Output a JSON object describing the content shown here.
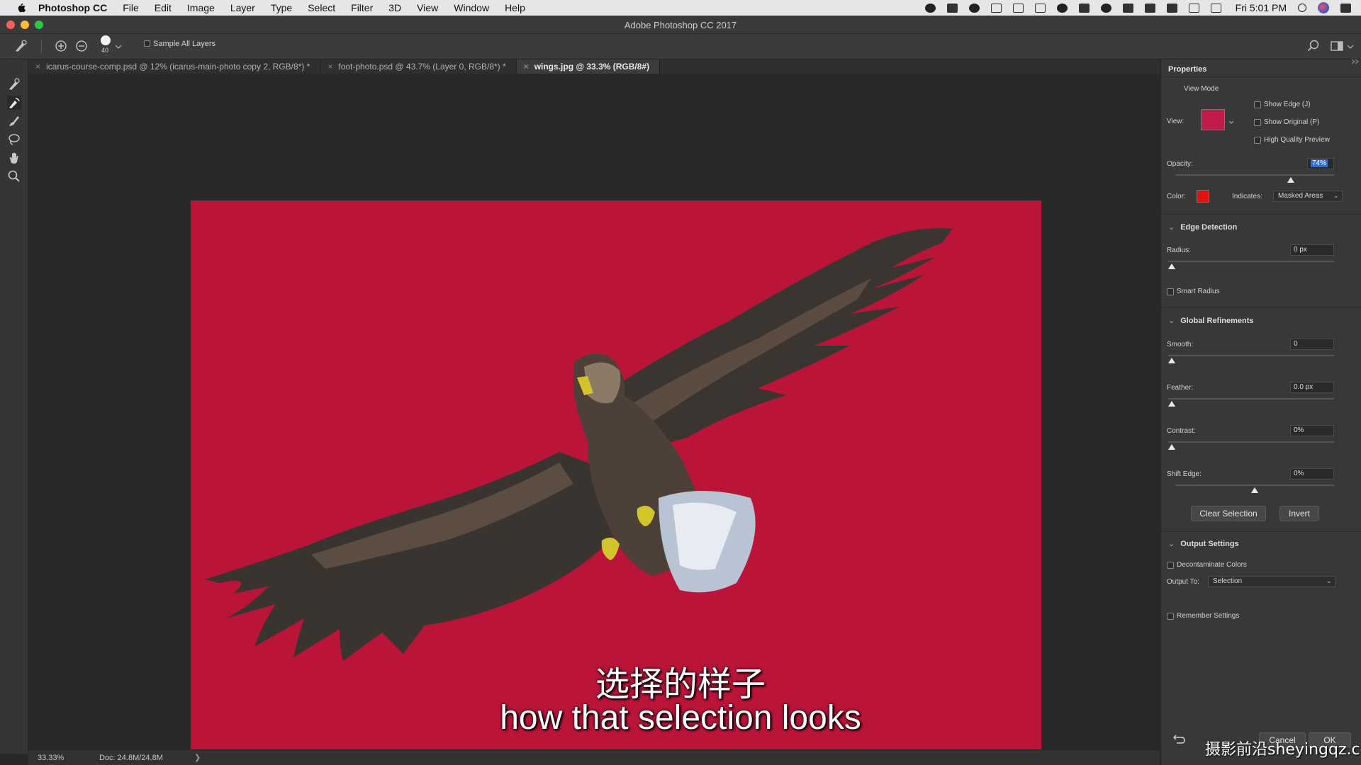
{
  "menubar": {
    "app_name": "Photoshop CC",
    "items": [
      "File",
      "Edit",
      "Image",
      "Layer",
      "Type",
      "Select",
      "Filter",
      "3D",
      "View",
      "Window",
      "Help"
    ],
    "clock": "Fri 5:01 PM"
  },
  "window": {
    "title": "Adobe Photoshop CC 2017"
  },
  "options_bar": {
    "brush_size": "40",
    "sample_all_layers_label": "Sample All Layers"
  },
  "tabs": [
    {
      "label": "icarus-course-comp.psd @ 12% (icarus-main-photo copy 2, RGB/8*) *"
    },
    {
      "label": "foot-photo.psd @ 43.7% (Layer 0, RGB/8*) *"
    },
    {
      "label": "wings.jpg @ 33.3% (RGB/8#)"
    }
  ],
  "status": {
    "zoom": "33.33%",
    "doc": "Doc: 24.8M/24.8M",
    "arrow": "❯"
  },
  "properties": {
    "title": "Properties",
    "view_mode": {
      "heading": "View Mode",
      "view_label": "View:",
      "show_edge": "Show Edge (J)",
      "show_original": "Show Original (P)",
      "high_quality_preview": "High Quality Preview"
    },
    "opacity_label": "Opacity:",
    "opacity_value": "74%",
    "opacity_level": 0.74,
    "color_label": "Color:",
    "color_value": "#e4110f",
    "indicates_label": "Indicates:",
    "indicates_value": "Masked Areas",
    "edge_detection": {
      "heading": "Edge Detection",
      "radius_label": "Radius:",
      "radius_value": "0 px",
      "smart_radius": "Smart Radius"
    },
    "global_refinements": {
      "heading": "Global Refinements",
      "smooth_label": "Smooth:",
      "smooth_value": "0",
      "feather_label": "Feather:",
      "feather_value": "0.0 px",
      "contrast_label": "Contrast:",
      "contrast_value": "0%",
      "shift_edge_label": "Shift Edge:",
      "shift_edge_value": "0%"
    },
    "clear_selection_label": "Clear Selection",
    "invert_label": "Invert",
    "output_settings": {
      "heading": "Output Settings",
      "decontaminate": "Decontaminate Colors",
      "output_to_label": "Output To:",
      "output_to_value": "Selection",
      "remember": "Remember Settings"
    },
    "cancel_label": "Cancel",
    "ok_label": "OK"
  },
  "subtitles": {
    "cn": "选择的样子",
    "en": "how that selection looks"
  },
  "watermark": "摄影前沿sheyingqz.com",
  "colors": {
    "canvas_overlay": "#ba1538",
    "panel": "#383838",
    "background": "#282828"
  }
}
